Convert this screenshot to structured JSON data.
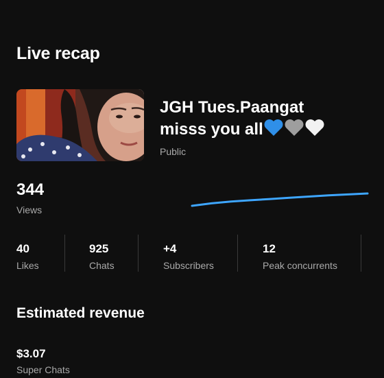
{
  "page": {
    "title": "Live recap"
  },
  "video": {
    "title_line1": "JGH Tues.Paangat",
    "title_line2": "misss you all",
    "title_emoji": [
      "blue-heart",
      "grey-heart",
      "white-heart"
    ],
    "visibility": "Public"
  },
  "views": {
    "value": "344",
    "label": "Views",
    "trend": [
      0.0,
      0.2,
      0.35,
      0.45,
      0.55,
      0.65,
      0.75,
      0.85,
      0.92,
      1.0
    ]
  },
  "stats": [
    {
      "value": "40",
      "label": "Likes"
    },
    {
      "value": "925",
      "label": "Chats"
    },
    {
      "value": "+4",
      "label": "Subscribers"
    },
    {
      "value": "12",
      "label": "Peak concurrents"
    }
  ],
  "revenue": {
    "section_title": "Estimated revenue",
    "value": "$3.07",
    "label": "Super Chats"
  },
  "colors": {
    "background": "#0f0f0f",
    "text_primary": "#ffffff",
    "text_secondary": "#aaaaaa",
    "sparkline": "#3ea6ff",
    "divider": "#3a3a3a"
  }
}
